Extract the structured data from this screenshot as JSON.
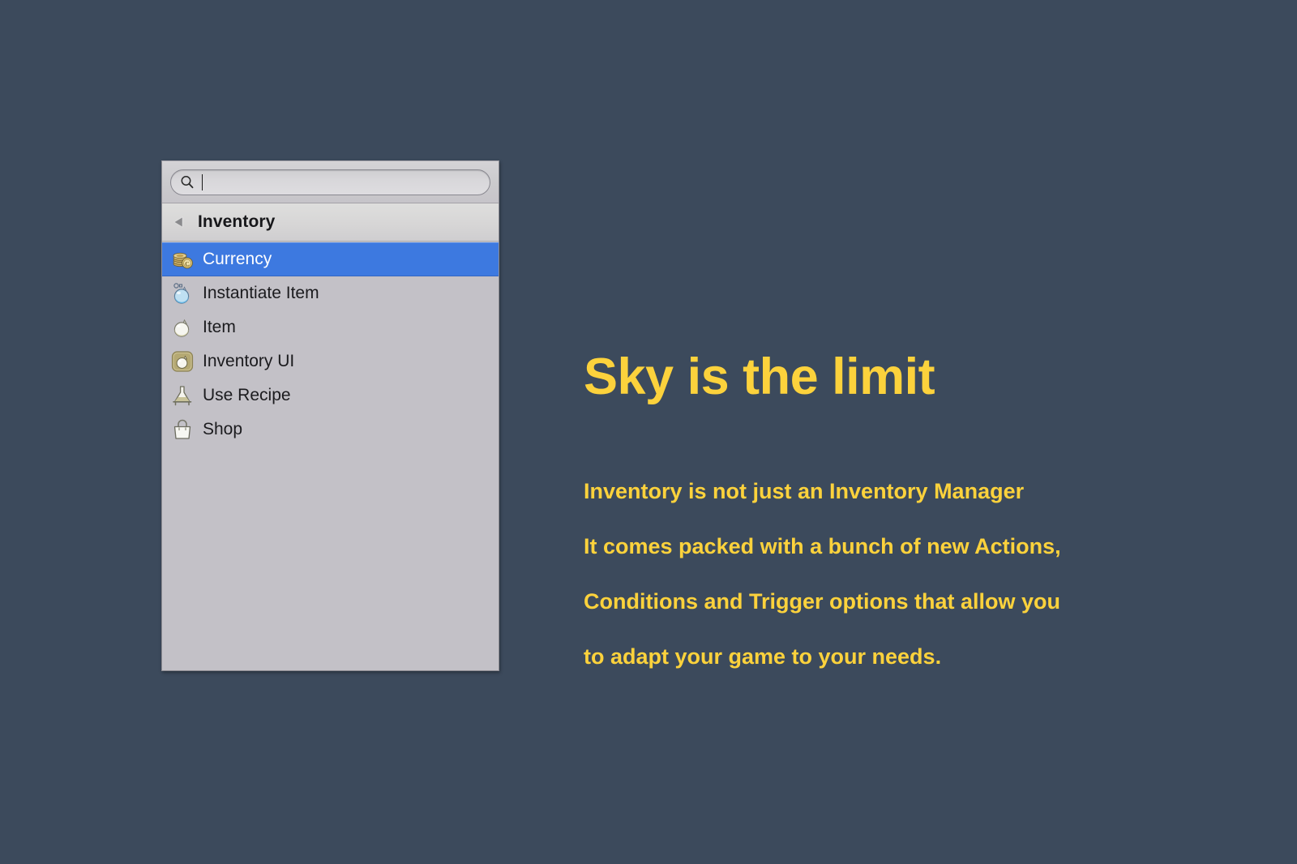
{
  "colors": {
    "background": "#3c4a5c",
    "accent_yellow": "#fcd23c",
    "selection_blue": "#3d79e0",
    "panel_body": "#c3c1c7",
    "panel_header": "#d7d6d6"
  },
  "popup": {
    "search": {
      "icon": "search-icon",
      "value": "",
      "placeholder": ""
    },
    "group_header": {
      "back_icon": "back-arrow-icon",
      "label": "Inventory"
    },
    "items": [
      {
        "label": "Currency",
        "icon": "coins-icon",
        "selected": true
      },
      {
        "label": "Instantiate Item",
        "icon": "blue-flask-icon",
        "selected": false
      },
      {
        "label": "Item",
        "icon": "white-flask-icon",
        "selected": false
      },
      {
        "label": "Inventory UI",
        "icon": "flask-badge-icon",
        "selected": false
      },
      {
        "label": "Use Recipe",
        "icon": "beaker-stand-icon",
        "selected": false
      },
      {
        "label": "Shop",
        "icon": "shopping-bag-icon",
        "selected": false
      }
    ]
  },
  "copy": {
    "headline": "Sky is the limit",
    "lines": [
      "Inventory is not just an Inventory Manager",
      "It comes packed with a bunch of new Actions,",
      "Conditions and Trigger options that allow you",
      "to adapt your game to your needs."
    ]
  }
}
